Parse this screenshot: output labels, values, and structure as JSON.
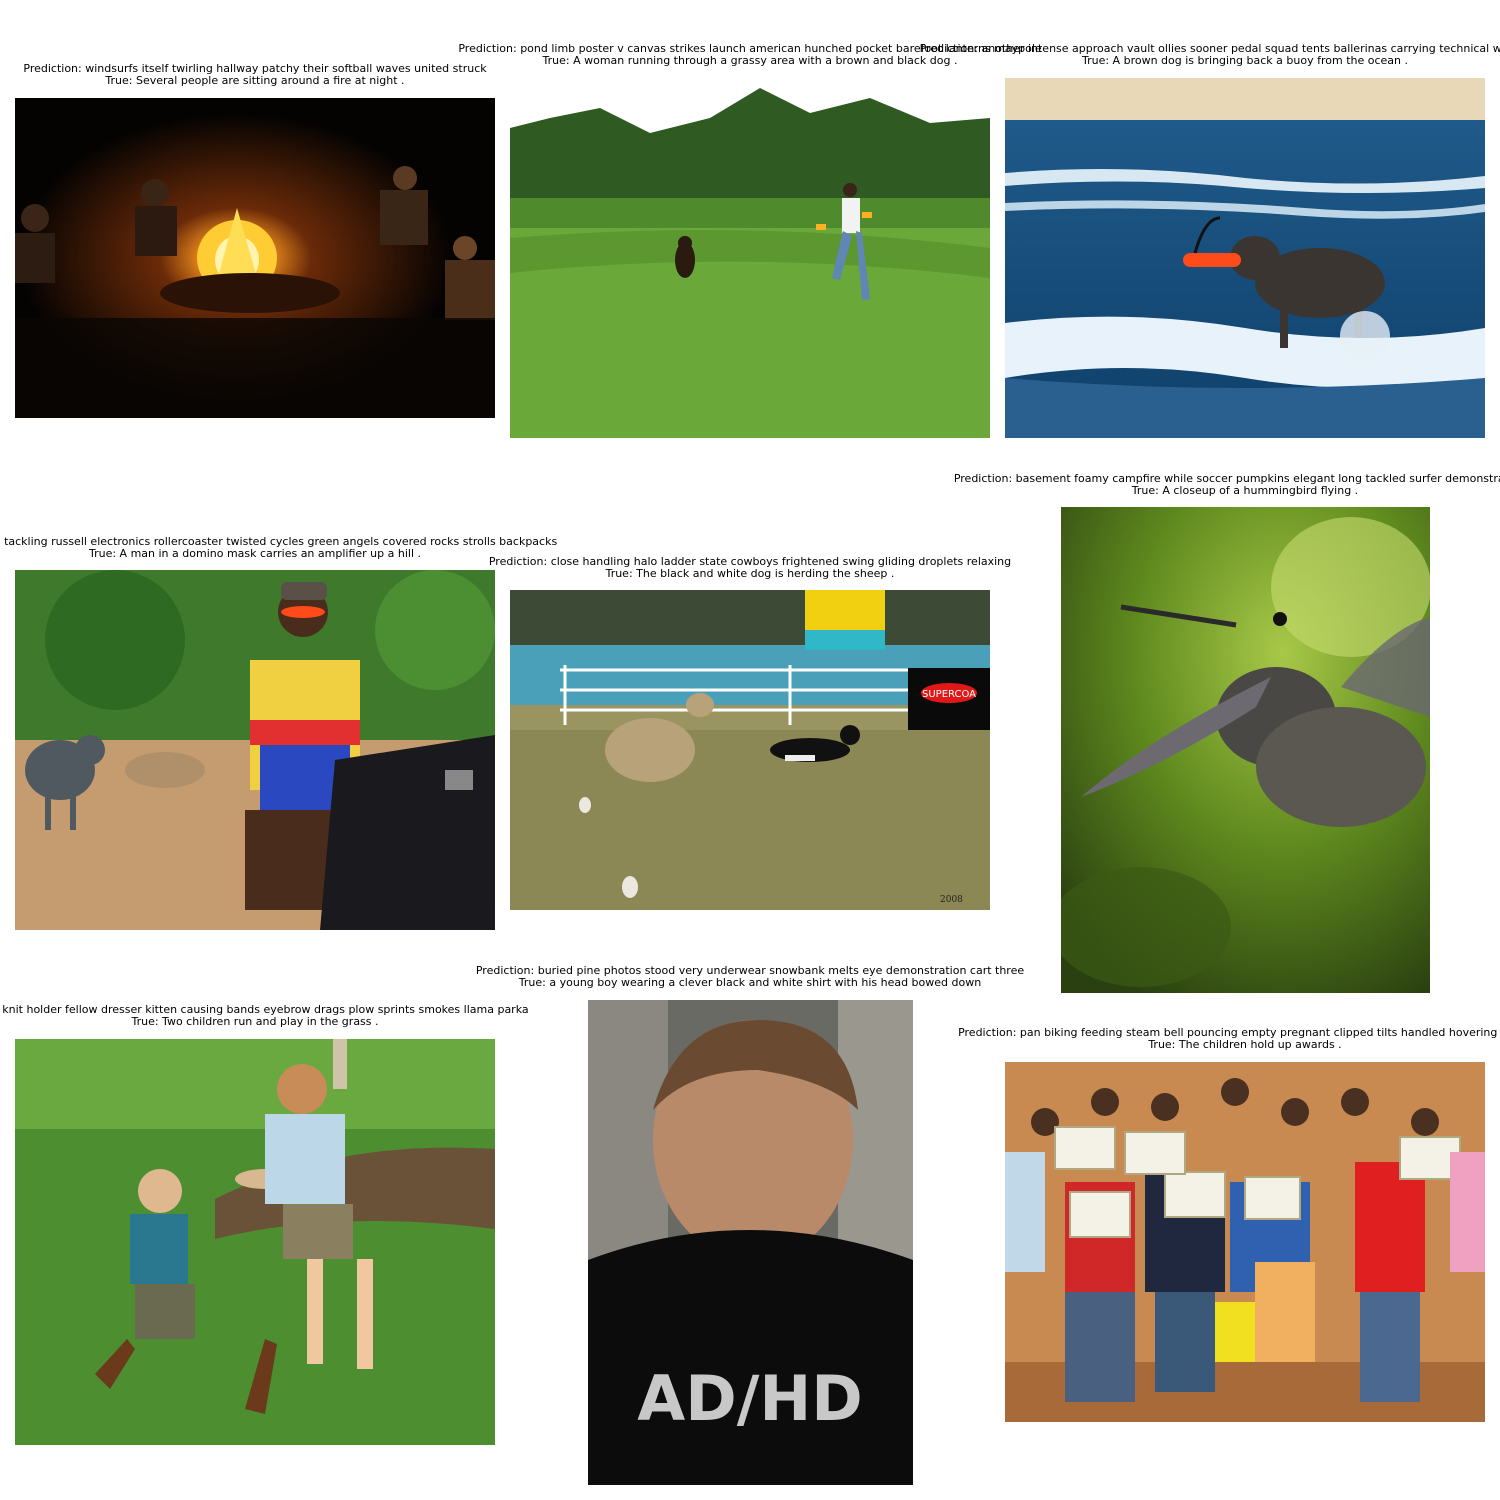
{
  "panels": [
    {
      "prediction": "Prediction: windsurfs itself twirling hallway patchy their softball waves united struck",
      "true": "True: Several people are sitting around a fire at night ."
    },
    {
      "prediction": "Prediction: pond limb poster v canvas strikes launch american hunched pocket barefoot  lanterns maypole",
      "true": "True: A woman running through a grassy area with a brown and black dog ."
    },
    {
      "prediction": "Prediction: another intense approach vault ollies sooner pedal squad tents ballerinas carrying technical wipes tinted a",
      "true": "True: A brown dog is bringing back a buoy from the ocean ."
    },
    {
      "prediction": "agpipers tackling russell electronics rollercoaster twisted cycles green angels covered rocks strolls backpacks",
      "true": "True: A man in a domino mask carries an amplifier up a hill ."
    },
    {
      "prediction": "Prediction: close handling halo ladder state cowboys frightened swing gliding droplets relaxing",
      "true": "True: The black and white dog is herding the sheep ."
    },
    {
      "prediction": "Prediction: basement foamy campfire while soccer pumpkins elegant long tackled surfer demonstration p",
      "true": "True: A closeup of a hummingbird flying ."
    },
    {
      "prediction": "on: knit holder fellow dresser kitten causing bands eyebrow drags plow sprints smokes llama parka",
      "true": "True: Two children run and play in the grass ."
    },
    {
      "prediction": "Prediction: buried pine photos stood very underwear snowbank melts eye demonstration cart three",
      "true": "True: a young boy wearing a clever black and white shirt with his head bowed down"
    },
    {
      "prediction": "Prediction: pan biking feeding steam bell pouncing empty pregnant clipped tilts handled hovering crafts",
      "true": "True: The children hold up awards ."
    }
  ],
  "shirt_text": "AD/HD",
  "signature": "2008"
}
